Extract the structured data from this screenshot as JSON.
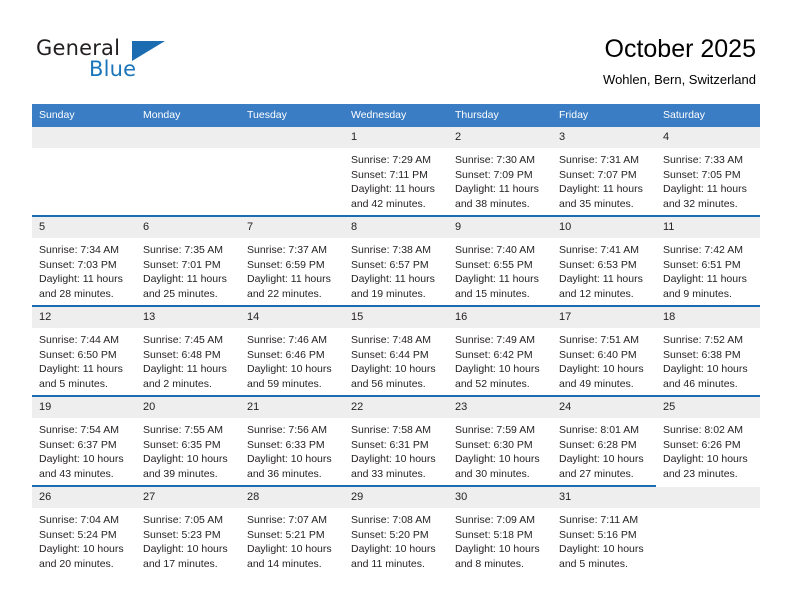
{
  "logo": {
    "word1": "General",
    "word2": "Blue",
    "accent_color": "#1b6cb0"
  },
  "header": {
    "title": "October 2025",
    "location": "Wohlen, Bern, Switzerland"
  },
  "theme": {
    "header_row_bg": "#3b7dc4",
    "row_divider": "#1b6cb0",
    "daynum_bg": "#eeeeee"
  },
  "weekdays": [
    "Sunday",
    "Monday",
    "Tuesday",
    "Wednesday",
    "Thursday",
    "Friday",
    "Saturday"
  ],
  "weeks": [
    [
      {
        "day": "",
        "lines": []
      },
      {
        "day": "",
        "lines": []
      },
      {
        "day": "",
        "lines": []
      },
      {
        "day": "1",
        "lines": [
          "Sunrise: 7:29 AM",
          "Sunset: 7:11 PM",
          "Daylight: 11 hours",
          "and 42 minutes."
        ]
      },
      {
        "day": "2",
        "lines": [
          "Sunrise: 7:30 AM",
          "Sunset: 7:09 PM",
          "Daylight: 11 hours",
          "and 38 minutes."
        ]
      },
      {
        "day": "3",
        "lines": [
          "Sunrise: 7:31 AM",
          "Sunset: 7:07 PM",
          "Daylight: 11 hours",
          "and 35 minutes."
        ]
      },
      {
        "day": "4",
        "lines": [
          "Sunrise: 7:33 AM",
          "Sunset: 7:05 PM",
          "Daylight: 11 hours",
          "and 32 minutes."
        ]
      }
    ],
    [
      {
        "day": "5",
        "lines": [
          "Sunrise: 7:34 AM",
          "Sunset: 7:03 PM",
          "Daylight: 11 hours",
          "and 28 minutes."
        ]
      },
      {
        "day": "6",
        "lines": [
          "Sunrise: 7:35 AM",
          "Sunset: 7:01 PM",
          "Daylight: 11 hours",
          "and 25 minutes."
        ]
      },
      {
        "day": "7",
        "lines": [
          "Sunrise: 7:37 AM",
          "Sunset: 6:59 PM",
          "Daylight: 11 hours",
          "and 22 minutes."
        ]
      },
      {
        "day": "8",
        "lines": [
          "Sunrise: 7:38 AM",
          "Sunset: 6:57 PM",
          "Daylight: 11 hours",
          "and 19 minutes."
        ]
      },
      {
        "day": "9",
        "lines": [
          "Sunrise: 7:40 AM",
          "Sunset: 6:55 PM",
          "Daylight: 11 hours",
          "and 15 minutes."
        ]
      },
      {
        "day": "10",
        "lines": [
          "Sunrise: 7:41 AM",
          "Sunset: 6:53 PM",
          "Daylight: 11 hours",
          "and 12 minutes."
        ]
      },
      {
        "day": "11",
        "lines": [
          "Sunrise: 7:42 AM",
          "Sunset: 6:51 PM",
          "Daylight: 11 hours",
          "and 9 minutes."
        ]
      }
    ],
    [
      {
        "day": "12",
        "lines": [
          "Sunrise: 7:44 AM",
          "Sunset: 6:50 PM",
          "Daylight: 11 hours",
          "and 5 minutes."
        ]
      },
      {
        "day": "13",
        "lines": [
          "Sunrise: 7:45 AM",
          "Sunset: 6:48 PM",
          "Daylight: 11 hours",
          "and 2 minutes."
        ]
      },
      {
        "day": "14",
        "lines": [
          "Sunrise: 7:46 AM",
          "Sunset: 6:46 PM",
          "Daylight: 10 hours",
          "and 59 minutes."
        ]
      },
      {
        "day": "15",
        "lines": [
          "Sunrise: 7:48 AM",
          "Sunset: 6:44 PM",
          "Daylight: 10 hours",
          "and 56 minutes."
        ]
      },
      {
        "day": "16",
        "lines": [
          "Sunrise: 7:49 AM",
          "Sunset: 6:42 PM",
          "Daylight: 10 hours",
          "and 52 minutes."
        ]
      },
      {
        "day": "17",
        "lines": [
          "Sunrise: 7:51 AM",
          "Sunset: 6:40 PM",
          "Daylight: 10 hours",
          "and 49 minutes."
        ]
      },
      {
        "day": "18",
        "lines": [
          "Sunrise: 7:52 AM",
          "Sunset: 6:38 PM",
          "Daylight: 10 hours",
          "and 46 minutes."
        ]
      }
    ],
    [
      {
        "day": "19",
        "lines": [
          "Sunrise: 7:54 AM",
          "Sunset: 6:37 PM",
          "Daylight: 10 hours",
          "and 43 minutes."
        ]
      },
      {
        "day": "20",
        "lines": [
          "Sunrise: 7:55 AM",
          "Sunset: 6:35 PM",
          "Daylight: 10 hours",
          "and 39 minutes."
        ]
      },
      {
        "day": "21",
        "lines": [
          "Sunrise: 7:56 AM",
          "Sunset: 6:33 PM",
          "Daylight: 10 hours",
          "and 36 minutes."
        ]
      },
      {
        "day": "22",
        "lines": [
          "Sunrise: 7:58 AM",
          "Sunset: 6:31 PM",
          "Daylight: 10 hours",
          "and 33 minutes."
        ]
      },
      {
        "day": "23",
        "lines": [
          "Sunrise: 7:59 AM",
          "Sunset: 6:30 PM",
          "Daylight: 10 hours",
          "and 30 minutes."
        ]
      },
      {
        "day": "24",
        "lines": [
          "Sunrise: 8:01 AM",
          "Sunset: 6:28 PM",
          "Daylight: 10 hours",
          "and 27 minutes."
        ]
      },
      {
        "day": "25",
        "lines": [
          "Sunrise: 8:02 AM",
          "Sunset: 6:26 PM",
          "Daylight: 10 hours",
          "and 23 minutes."
        ]
      }
    ],
    [
      {
        "day": "26",
        "lines": [
          "Sunrise: 7:04 AM",
          "Sunset: 5:24 PM",
          "Daylight: 10 hours",
          "and 20 minutes."
        ]
      },
      {
        "day": "27",
        "lines": [
          "Sunrise: 7:05 AM",
          "Sunset: 5:23 PM",
          "Daylight: 10 hours",
          "and 17 minutes."
        ]
      },
      {
        "day": "28",
        "lines": [
          "Sunrise: 7:07 AM",
          "Sunset: 5:21 PM",
          "Daylight: 10 hours",
          "and 14 minutes."
        ]
      },
      {
        "day": "29",
        "lines": [
          "Sunrise: 7:08 AM",
          "Sunset: 5:20 PM",
          "Daylight: 10 hours",
          "and 11 minutes."
        ]
      },
      {
        "day": "30",
        "lines": [
          "Sunrise: 7:09 AM",
          "Sunset: 5:18 PM",
          "Daylight: 10 hours",
          "and 8 minutes."
        ]
      },
      {
        "day": "31",
        "lines": [
          "Sunrise: 7:11 AM",
          "Sunset: 5:16 PM",
          "Daylight: 10 hours",
          "and 5 minutes."
        ]
      },
      {
        "day": "",
        "lines": []
      }
    ]
  ]
}
